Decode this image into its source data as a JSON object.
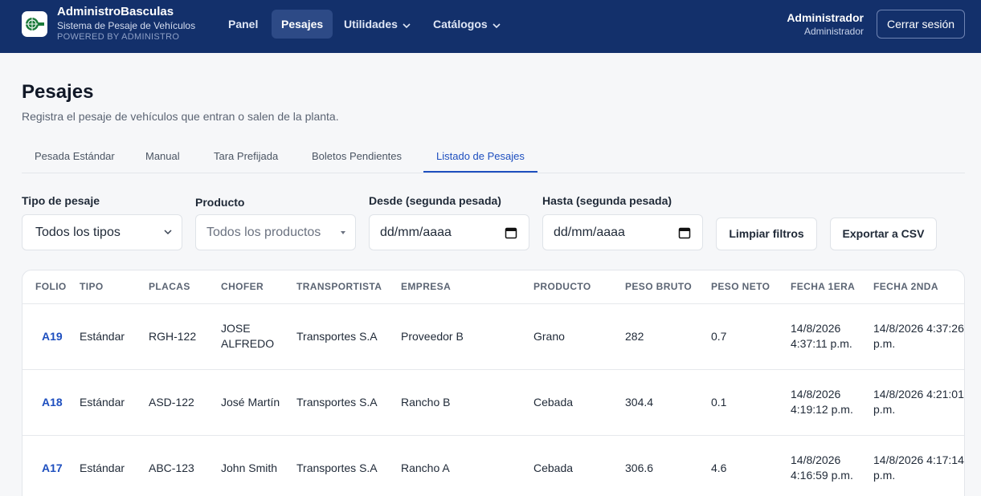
{
  "brand": {
    "title": "AdministroBasculas",
    "subtitle": "Sistema de Pesaje de Vehículos",
    "powered": "POWERED BY ADMINISTRO"
  },
  "nav": {
    "items": [
      {
        "label": "Panel"
      },
      {
        "label": "Pesajes"
      },
      {
        "label": "Utilidades"
      },
      {
        "label": "Catálogos"
      }
    ]
  },
  "user": {
    "name": "Administrador",
    "role": "Administrador",
    "logout_label": "Cerrar sesión"
  },
  "page": {
    "title": "Pesajes",
    "description": "Registra el pesaje de vehículos que entran o salen de la planta."
  },
  "tabs": [
    {
      "label": "Pesada Estándar"
    },
    {
      "label": "Manual"
    },
    {
      "label": "Tara Prefijada"
    },
    {
      "label": "Boletos Pendientes"
    },
    {
      "label": "Listado de Pesajes"
    }
  ],
  "filters": {
    "tipo": {
      "label": "Tipo de pesaje",
      "value": "Todos los tipos"
    },
    "producto": {
      "label": "Producto",
      "value": "Todos los productos"
    },
    "desde": {
      "label": "Desde (segunda pesada)",
      "value": "dd/mm/aaaa"
    },
    "hasta": {
      "label": "Hasta (segunda pesada)",
      "value": "dd/mm/aaaa"
    },
    "clear_label": "Limpiar filtros",
    "export_label": "Exportar a CSV"
  },
  "table": {
    "headers": [
      "FOLIO",
      "TIPO",
      "PLACAS",
      "CHOFER",
      "TRANSPORTISTA",
      "EMPRESA",
      "PRODUCTO",
      "PESO BRUTO",
      "PESO NETO",
      "FECHA 1ERA",
      "FECHA 2NDA"
    ],
    "rows": [
      {
        "folio": "A19",
        "tipo": "Estándar",
        "placas": "RGH-122",
        "chofer": "JOSE ALFREDO",
        "transportista": "Transportes S.A",
        "empresa": "Proveedor B",
        "producto": "Grano",
        "bruto": "282",
        "neto": "0.7",
        "fecha1": "14/8/2026 4:37:11 p.m.",
        "fecha2": "14/8/2026 4:37:26 p.m."
      },
      {
        "folio": "A18",
        "tipo": "Estándar",
        "placas": "ASD-122",
        "chofer": "José Martín",
        "transportista": "Transportes S.A",
        "empresa": "Rancho B",
        "producto": "Cebada",
        "bruto": "304.4",
        "neto": "0.1",
        "fecha1": "14/8/2026 4:19:12 p.m.",
        "fecha2": "14/8/2026 4:21:01 p.m."
      },
      {
        "folio": "A17",
        "tipo": "Estándar",
        "placas": "ABC-123",
        "chofer": "John Smith",
        "transportista": "Transportes S.A",
        "empresa": "Rancho A",
        "producto": "Cebada",
        "bruto": "306.6",
        "neto": "4.6",
        "fecha1": "14/8/2026 4:16:59 p.m.",
        "fecha2": "14/8/2026 4:17:14 p.m."
      }
    ]
  },
  "colors": {
    "header_bg": "#13306b",
    "accent": "#1e4fbf"
  }
}
